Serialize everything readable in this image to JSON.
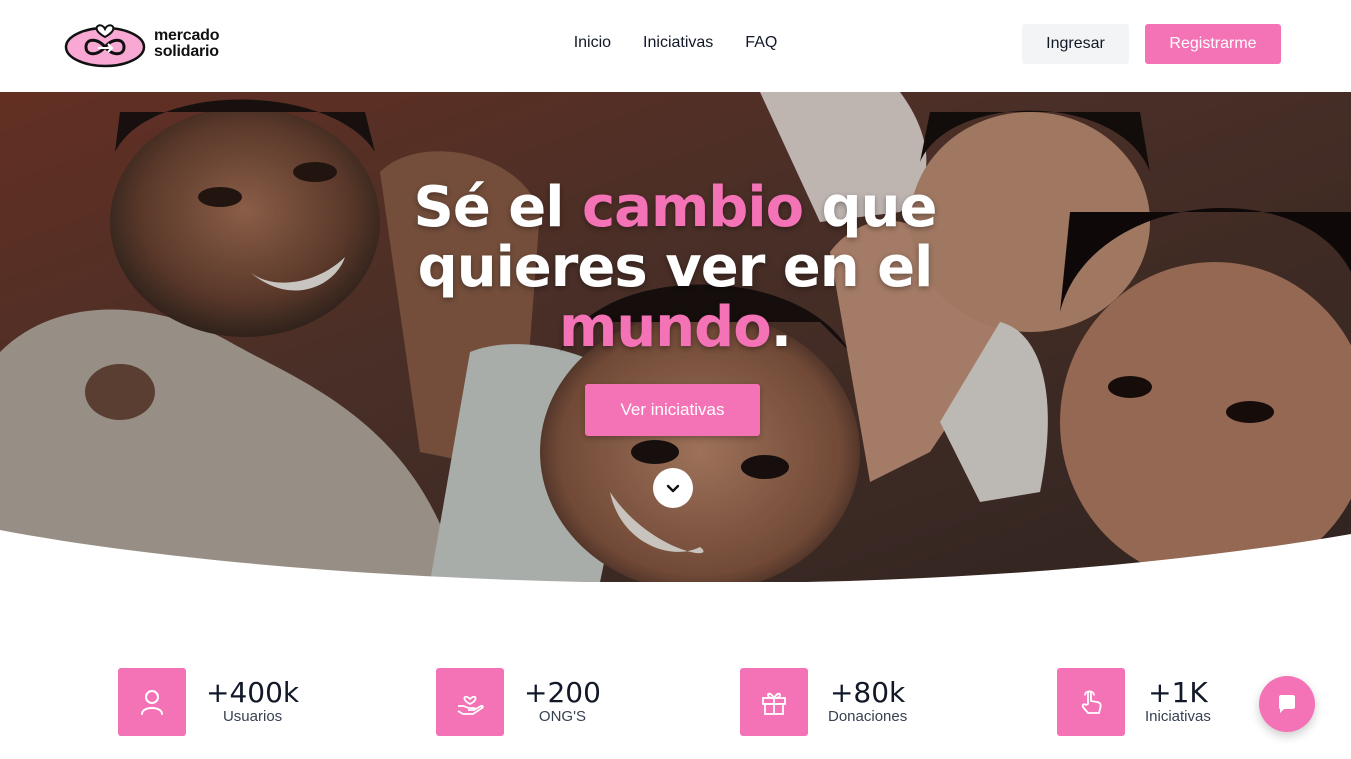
{
  "brand": {
    "line1": "mercado",
    "line2": "solidario",
    "color": "#f472b6"
  },
  "nav": {
    "links": [
      "Inicio",
      "Iniciativas",
      "FAQ"
    ]
  },
  "auth": {
    "login_label": "Ingresar",
    "register_label": "Registrarme"
  },
  "hero": {
    "title_part1": "Sé el ",
    "title_highlight1": "cambio",
    "title_part2": " que quieres ver en el ",
    "title_highlight2": "mundo",
    "title_part3": ".",
    "cta_label": "Ver iniciativas",
    "scroll_icon": "chevron-down-icon",
    "image_description_icon": "hero-photo"
  },
  "stats": [
    {
      "value": "+400k",
      "label": "Usuarios",
      "icon": "user-icon"
    },
    {
      "value": "+200",
      "label": "ONG'S",
      "icon": "hand-heart-icon"
    },
    {
      "value": "+80k",
      "label": "Donaciones",
      "icon": "gift-icon"
    },
    {
      "value": "+1K",
      "label": "Iniciativas",
      "icon": "pointer-hand-icon"
    }
  ],
  "chat": {
    "icon": "chat-bubble-icon"
  }
}
